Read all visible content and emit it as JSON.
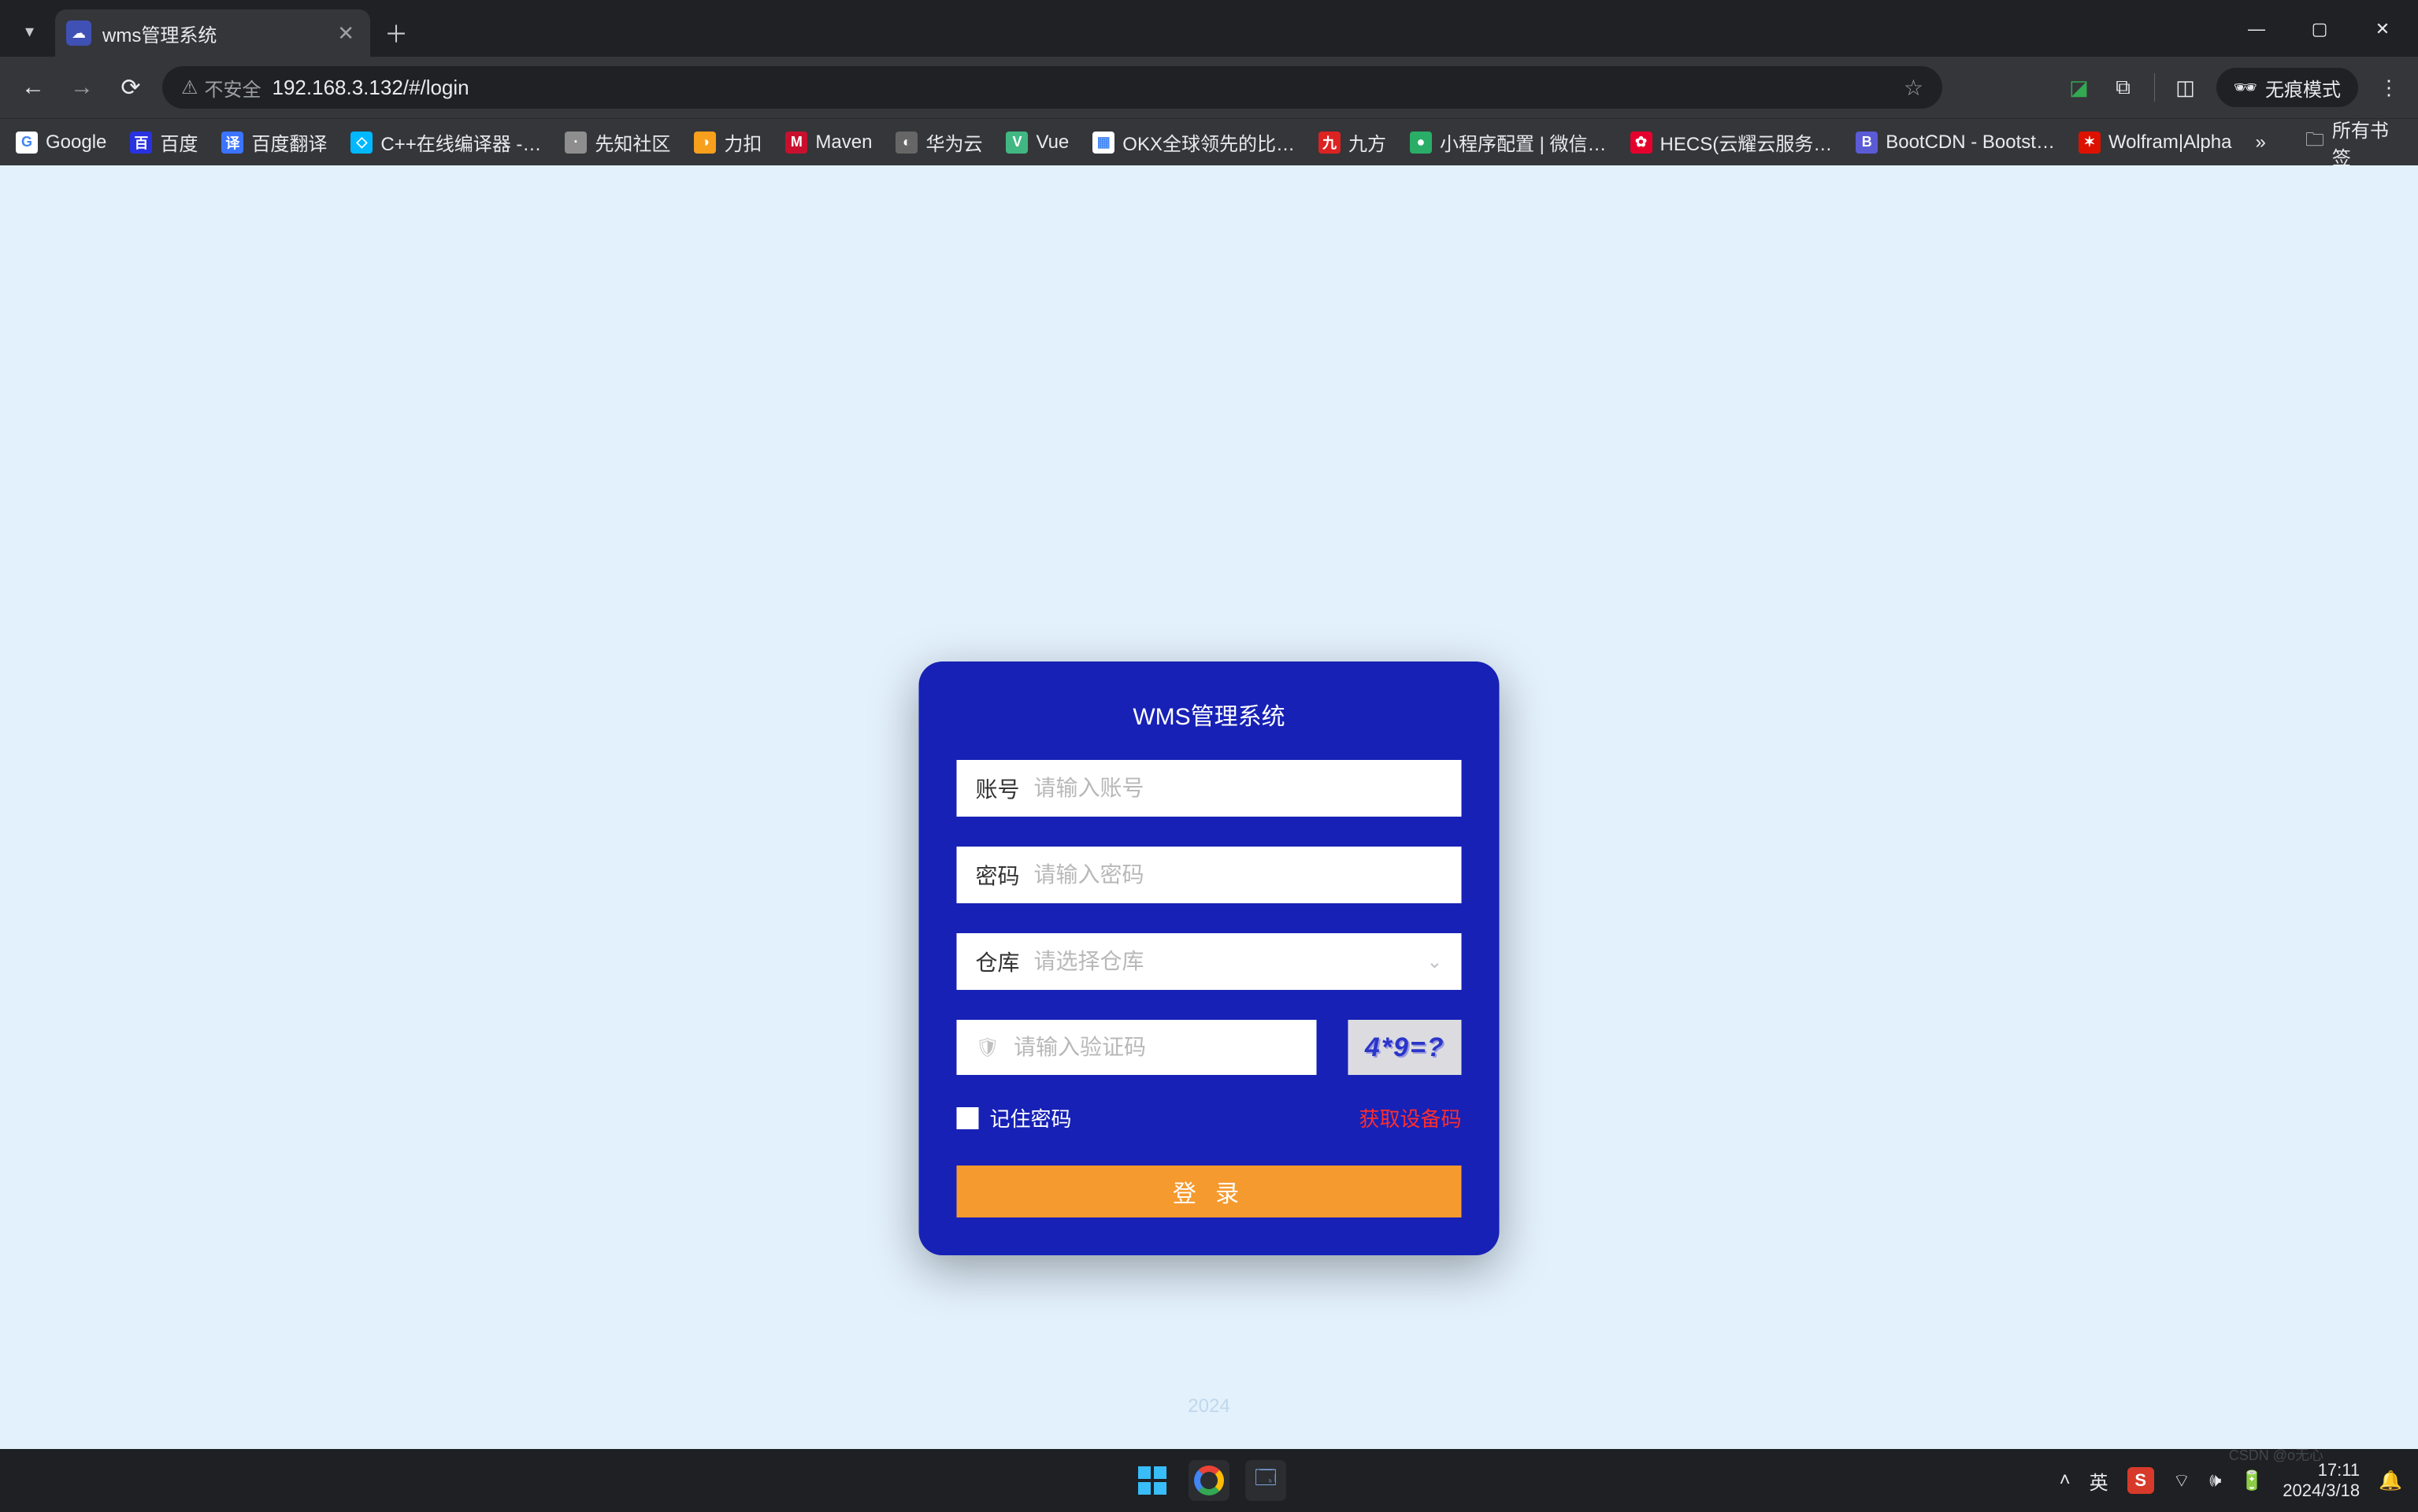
{
  "browser": {
    "tab": {
      "title": "wms管理系统"
    },
    "address": {
      "security_label": "不安全",
      "url": "192.168.3.132/#/login"
    },
    "incognito_label": "无痕模式",
    "bookmarks": [
      {
        "label": "Google",
        "color": "#ffffff",
        "glyph": "G"
      },
      {
        "label": "百度",
        "color": "#2932e1",
        "glyph": "百"
      },
      {
        "label": "百度翻译",
        "color": "#3b74ff",
        "glyph": "译"
      },
      {
        "label": "C++在线编译器 -…",
        "color": "#00b8ff",
        "glyph": "◇"
      },
      {
        "label": "先知社区",
        "color": "#8e8e8e",
        "glyph": "·"
      },
      {
        "label": "力扣",
        "color": "#f89f1b",
        "glyph": "◑"
      },
      {
        "label": "Maven",
        "color": "#c8102e",
        "glyph": "M"
      },
      {
        "label": "华为云",
        "color": "#666666",
        "glyph": "◐"
      },
      {
        "label": "Vue",
        "color": "#41b883",
        "glyph": "V"
      },
      {
        "label": "OKX全球领先的比…",
        "color": "#ffffff",
        "glyph": "▦"
      },
      {
        "label": "九方",
        "color": "#d22",
        "glyph": "九"
      },
      {
        "label": "小程序配置 | 微信…",
        "color": "#2aae67",
        "glyph": "●"
      },
      {
        "label": "HECS(云耀云服务…",
        "color": "#e6002d",
        "glyph": "✿"
      },
      {
        "label": "BootCDN - Bootst…",
        "color": "#5b5bd6",
        "glyph": "B"
      },
      {
        "label": "Wolfram|Alpha",
        "color": "#dd1100",
        "glyph": "✶"
      }
    ],
    "all_bookmarks_label": "所有书签"
  },
  "login": {
    "title": "WMS管理系统",
    "account_label": "账号",
    "account_placeholder": "请输入账号",
    "password_label": "密码",
    "password_placeholder": "请输入密码",
    "warehouse_label": "仓库",
    "warehouse_placeholder": "请选择仓库",
    "captcha_placeholder": "请输入验证码",
    "captcha_text": "4*9=?",
    "remember_label": "记住密码",
    "device_code_label": "获取设备码",
    "login_button": "登 录",
    "footer_year": "2024"
  },
  "taskbar": {
    "ime_lang": "英",
    "ime_s": "S",
    "time": "17:11",
    "date": "2024/3/18",
    "watermark": "CSDN @o无心"
  }
}
